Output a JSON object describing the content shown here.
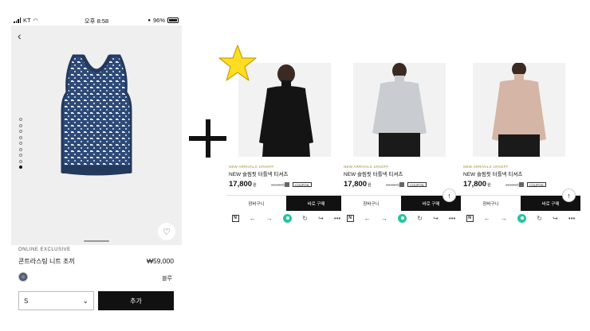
{
  "status_bar": {
    "carrier": "KT",
    "time": "오후 8:58",
    "battery": "96%"
  },
  "product": {
    "label": "ONLINE EXCLUSIVE",
    "name": "콘트라스팅 니트 조끼",
    "price": "₩59,000",
    "color": "블루",
    "size": "S",
    "add_button": "추가",
    "image_count": 9,
    "active_image_index": 9
  },
  "cards": [
    {
      "label": "NEW ARRIVALS 10%OFF",
      "name": "NEW 슬림핏 터틀넥 티셔츠",
      "price": "17,800",
      "currency": "원",
      "original_price": "19,800원",
      "coupon": "COUPON",
      "cart_label": "장바구니",
      "buy_label": "바로 구매",
      "shirt_color": "#141414",
      "highlighted": true
    },
    {
      "label": "NEW ARRIVALS 10%OFF",
      "name": "NEW 슬림핏 터틀넥 티셔츠",
      "price": "17,800",
      "currency": "원",
      "original_price": "19,800원",
      "coupon": "COUPON",
      "cart_label": "장바구니",
      "buy_label": "바로 구매",
      "shirt_color": "#c9ccd0",
      "highlighted": false
    },
    {
      "label": "NEW ARRIVALS 10%OFF",
      "name": "NEW 슬림핏 터틀넥 티셔츠",
      "price": "17,800",
      "currency": "원",
      "original_price": "19,800원",
      "coupon": "COUPON",
      "cart_label": "장바구니",
      "buy_label": "바로 구매",
      "shirt_color": "#d4b5a6",
      "highlighted": false
    }
  ],
  "colors": {
    "accent_green": "#27c4a0",
    "star": "#ffdd22",
    "vest_navy": "#2d4a78"
  },
  "icons": [
    "back-icon",
    "heart-icon",
    "chevron-down-icon",
    "star-icon",
    "plus-icon",
    "n-icon",
    "arrow-left-icon",
    "arrow-right-icon",
    "home-icon",
    "refresh-icon",
    "share-icon",
    "more-icon",
    "scroll-top-icon"
  ]
}
